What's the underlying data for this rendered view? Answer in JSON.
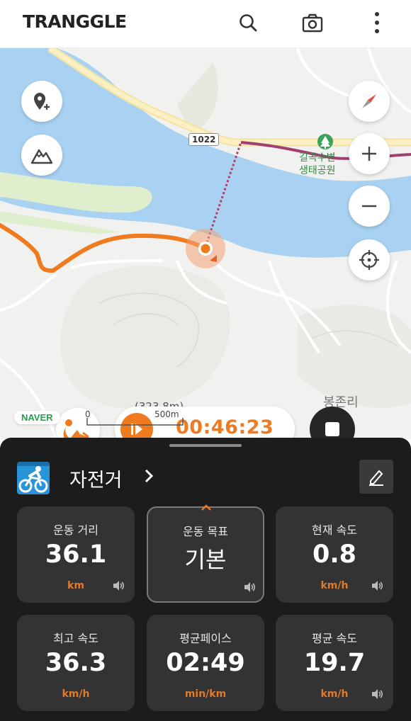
{
  "app": {
    "logo": "TRANGGLE",
    "header_icons": [
      "search-icon",
      "camera-icon",
      "more-vertical-icon"
    ]
  },
  "map": {
    "road_number": "1022",
    "park_label_line1": "길곡수변",
    "park_label_line2": "생태공원",
    "place_label": "봉존리",
    "elevation_label": "(323.8m)",
    "scale_start": "0",
    "scale_end": "500m",
    "provider": "NAVER",
    "side_buttons_left": [
      "add-waypoint-icon",
      "mountain-icon"
    ],
    "side_buttons_right": [
      "compass-icon",
      "zoom-in-icon",
      "zoom-out-icon",
      "locate-icon"
    ],
    "colors": {
      "water": "#a9d2f2",
      "track": "#f07a1e",
      "road_yellow": "#f7e9a6",
      "land": "#f1f1ef",
      "park": "#dfeecd"
    }
  },
  "workout": {
    "activity_icon": "stretching-icon",
    "elapsed_time": "00:46:23",
    "accent_color": "#ef7a1f"
  },
  "panel": {
    "sport": "자전거",
    "sport_icon": "bicycle-icon",
    "metrics": [
      {
        "label": "운동 거리",
        "value": "36.1",
        "unit": "km"
      },
      {
        "label": "운동 목표",
        "value": "기본",
        "unit": ""
      },
      {
        "label": "현재 속도",
        "value": "0.8",
        "unit": "km/h"
      },
      {
        "label": "최고 속도",
        "value": "36.3",
        "unit": "km/h"
      },
      {
        "label": "평균페이스",
        "value": "02:49",
        "unit": "min/km"
      },
      {
        "label": "평균 속도",
        "value": "19.7",
        "unit": "km/h"
      }
    ]
  }
}
